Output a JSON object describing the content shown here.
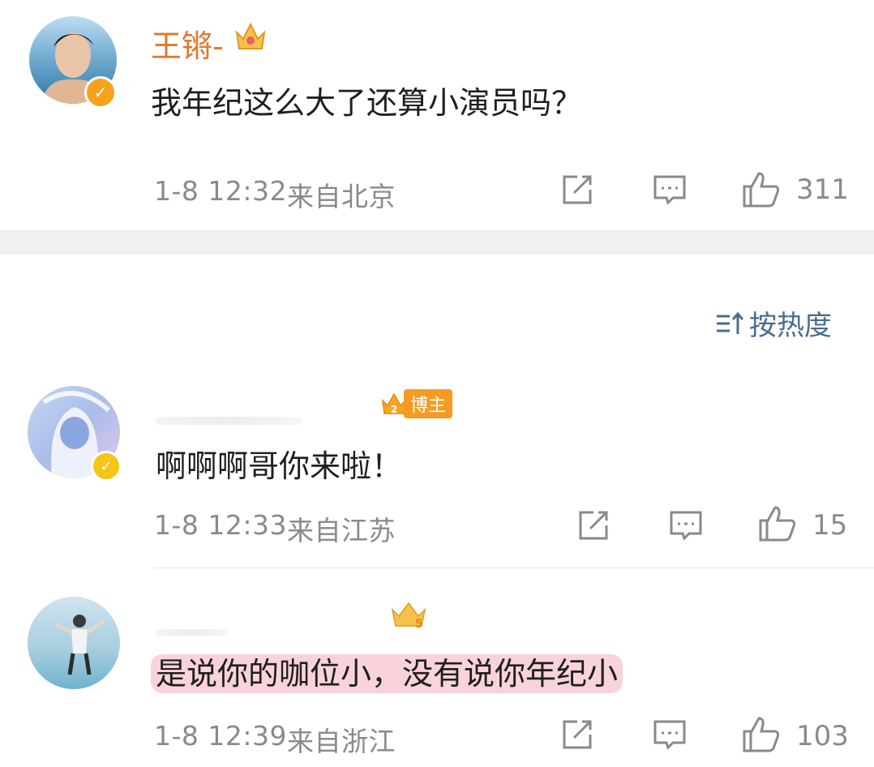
{
  "post": {
    "author": "王锵-",
    "content": "我年纪这么大了还算小演员吗？",
    "time": "1-8 12:32",
    "source": "来自北京",
    "like_count": "311"
  },
  "sort": {
    "label": "按热度",
    "icon": "sort-icon"
  },
  "comments": [
    {
      "content": "啊啊啊哥你来啦！",
      "badge_text": "博主",
      "time": "1-8 12:33",
      "source": "来自江苏",
      "like_count": "15"
    },
    {
      "content": "是说你的咖位小，没有说你年纪小",
      "time": "1-8 12:39",
      "source": "来自浙江",
      "like_count": "103"
    }
  ],
  "colors": {
    "name": "#e0782d",
    "verify": "#f7a21b",
    "sort": "#4a6d8f",
    "highlight": "#ee8296"
  }
}
